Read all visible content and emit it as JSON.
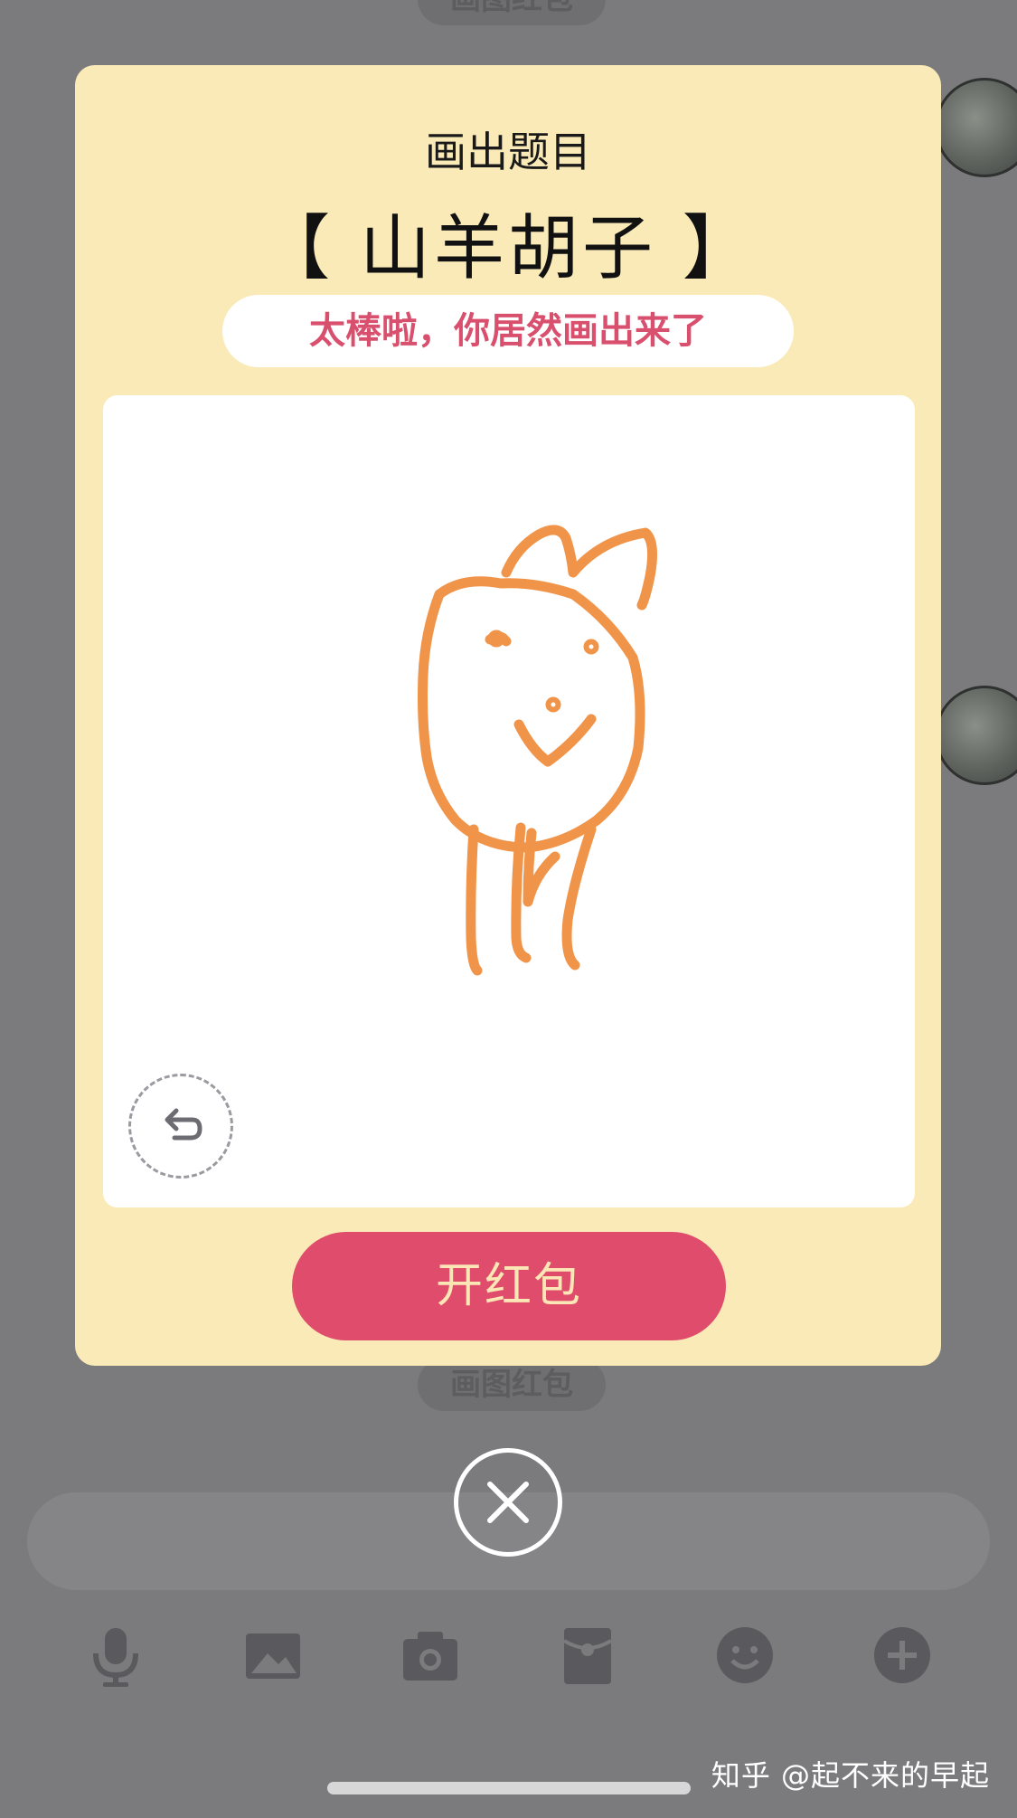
{
  "background": {
    "top_pill_label": "画图红包",
    "mid_pill_label": "画图红包"
  },
  "card": {
    "title": "画出题目",
    "subject": "【 山羊胡子 】",
    "praise": "太棒啦，你居然画出来了",
    "open_button_label": "开红包",
    "drawing_color": "#f0944a",
    "accent_color": "#e04d6c",
    "card_color": "#faeab8"
  },
  "icons": {
    "undo": "undo-icon",
    "close": "close-icon",
    "toolbar": [
      "microphone-icon",
      "image-icon",
      "camera-icon",
      "red-packet-icon",
      "emoji-icon",
      "plus-icon"
    ]
  },
  "watermark": "知乎 @起不来的早起"
}
